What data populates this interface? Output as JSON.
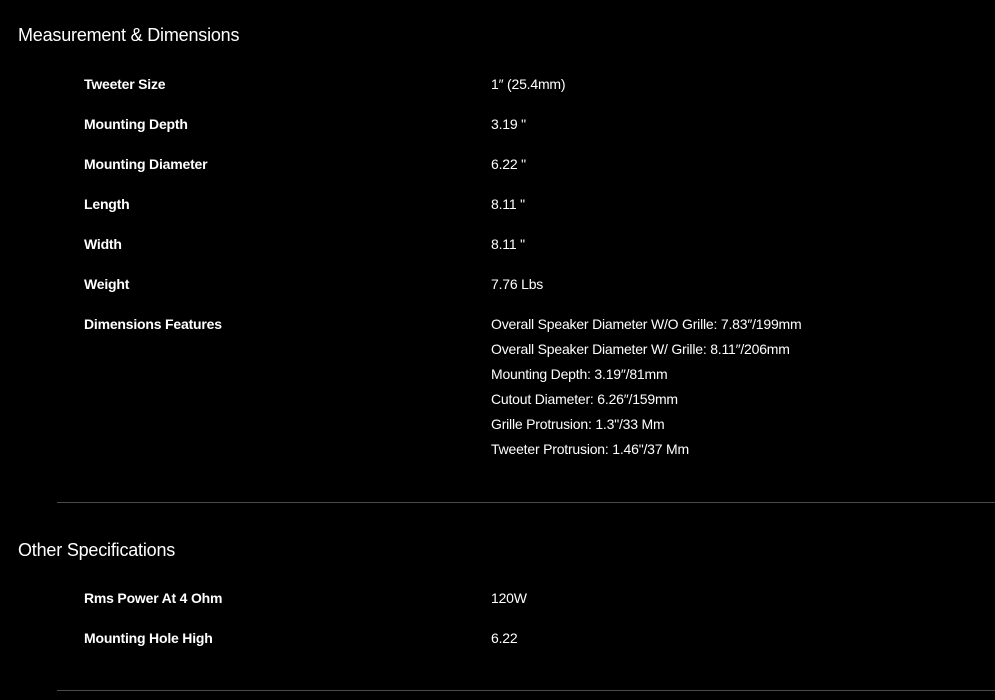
{
  "sections": [
    {
      "title": "Measurement & Dimensions",
      "rows": [
        {
          "label": "Tweeter Size",
          "value": "1″ (25.4mm)"
        },
        {
          "label": "Mounting Depth",
          "value": "3.19 \""
        },
        {
          "label": "Mounting Diameter",
          "value": "6.22 \""
        },
        {
          "label": "Length",
          "value": "8.11 \""
        },
        {
          "label": "Width",
          "value": "8.11 \""
        },
        {
          "label": "Weight",
          "value": "7.76 Lbs"
        }
      ],
      "features": {
        "label": "Dimensions Features",
        "lines": [
          "Overall Speaker Diameter W/O Grille: 7.83″/199mm",
          "Overall Speaker Diameter W/ Grille: 8.11″/206mm",
          "Mounting Depth: 3.19″/81mm",
          "Cutout Diameter: 6.26″/159mm",
          "Grille Protrusion: 1.3\"/33 Mm",
          "Tweeter Protrusion: 1.46\"/37 Mm"
        ]
      }
    },
    {
      "title": "Other Specifications",
      "rows": [
        {
          "label": "Rms Power At 4 Ohm",
          "value": "120W"
        },
        {
          "label": "Mounting Hole High",
          "value": "6.22"
        }
      ]
    }
  ]
}
